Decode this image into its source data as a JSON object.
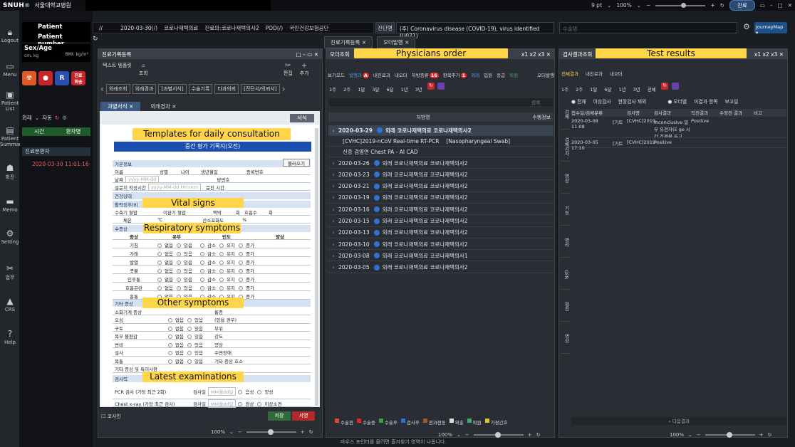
{
  "topbar": {
    "logo": "SNUH",
    "logo_sup": "®",
    "hospital": "서울대학교병원",
    "font_size": "9 pt",
    "zoom": "100%",
    "mode": "진료"
  },
  "rail": {
    "items": [
      "Logout",
      "Menu",
      "Patient List",
      "Patient Summary",
      "회진",
      "Memo",
      "Setting",
      "업무",
      "CRS",
      "Help"
    ]
  },
  "patient": {
    "name_label": "Patient name",
    "number_label": "Patient number",
    "sexage": "Sex/Age",
    "measures": "cm, kg",
    "bmi": "BMI: kg/m²",
    "badge_r": "R",
    "badge_ttl": "진료\n회송",
    "dept": "외래",
    "auto": "자동",
    "hist_cols": [
      "시간",
      "환자명"
    ],
    "hist_section": "진료분환자",
    "hist_date": "2020-03-30 11:01:16"
  },
  "infobar": {
    "sep": "//",
    "date": "2020-03-30(/)",
    "dept": "코로나재택의료",
    "doctor": "진료의:코로나재택의사2",
    "pod": "POD(/)",
    "insurance": "국민건강보험공단"
  },
  "dx": {
    "label": "진단명",
    "value": "(주) Coronavirus disease (COVID-19), virus identified (U071)",
    "search_ph": "수술명"
  },
  "journey": "JourneyMap ▾",
  "tabs": [
    "진료기록등록",
    "오더발행"
  ],
  "p1": {
    "title": "진료기록등록",
    "tools": [
      "텍스트 템플릿",
      "조회",
      "편집",
      "추가"
    ],
    "chips": [
      "외래조회",
      "외래경과",
      "[과별서식]",
      "수술기록",
      "타과의뢰",
      "[진단서/의뢰서]"
    ],
    "subtabs": [
      "과별서식",
      "외래경과"
    ],
    "format_btn": "서식",
    "annotation_templates": "Templates for daily consultation",
    "form_title": "중간 평가 기록지(오전)",
    "load_btn": "불러오기",
    "annotation_vitals": "Vital signs",
    "annotation_resp": "Respiratory symptoms",
    "annotation_other": "Other symptoms",
    "annotation_exam": "Latest examinations",
    "sections": {
      "basic": "기본정보",
      "health": "건강상태",
      "vital": "활력징후(비",
      "symptom": "수증상",
      "other": "기타 증상",
      "exam": "검사력"
    },
    "fields": {
      "name": "이름",
      "sex": "성별",
      "age": "나이",
      "dob": "생년월일",
      "reg": "등록번호",
      "date": "날짜",
      "date_ph": "yyyy-MM-dd",
      "ward": "방번호",
      "survey": "설문지 작성시간",
      "survey_ph": "yyyy-MM-dd HH:mm",
      "consult": "문진 시간",
      "sbp": "수축기 혈압",
      "dbp": "이완기 혈압",
      "pulse": "맥박",
      "times": "회",
      "resp": "호흡수",
      "temp": "체온",
      "celsius": "℃",
      "spo2": "산소포화도",
      "pct": "%"
    },
    "sym_cols": [
      "증상",
      "유무",
      "빈도",
      "양상"
    ],
    "symptoms": [
      "기침",
      "가래",
      "발열",
      "콧물",
      "인후통",
      "호흡곤란",
      "흉통"
    ],
    "opts": {
      "no": "없음",
      "yes": "있음",
      "dec": "감소",
      "same": "유지",
      "inc": "증가"
    },
    "other_rows": [
      "소화기계 증상",
      "오심",
      "구토",
      "복부 불편감",
      "변비",
      "설사",
      "복통",
      "기타 증상 및 특이사항"
    ],
    "other_right": [
      "통증",
      "(있을 경우)",
      "부위",
      "강도",
      "양상",
      "수면장애",
      "기타 증상 호소"
    ],
    "exams": [
      "PCR 검사 (가장 최근 2회)",
      "Chest x-ray (가장 최근 검사)"
    ],
    "exam_date": "검사일",
    "exam_ph": "MM월dd일",
    "pos": "음성",
    "neg": "양성",
    "normal": "정상",
    "abnormal": "이상소견",
    "check": "코사인",
    "save": "저장",
    "sign": "서명",
    "zoom": "100%"
  },
  "p2": {
    "title": "오더조회",
    "header": "Physicians order",
    "win": [
      "x1",
      "x2",
      "x3"
    ],
    "tools": [
      "보기모드",
      "발행과",
      "내진료과",
      "내오더",
      "처방종류",
      "항목추가",
      "외래",
      "입원",
      "응급",
      "퇴원",
      "오더발행"
    ],
    "badges": [
      "A",
      "16",
      "1"
    ],
    "timeline": [
      "1주",
      "2주",
      "1달",
      "3달",
      "6달",
      "1년",
      "3년"
    ],
    "search_ph": "검색",
    "cols": [
      "처방명",
      "수행정보"
    ],
    "first": {
      "date": "2020-03-29",
      "desc": "외래 코로나재택의료 코로나재택의사2",
      "sub1": "[CVHC]2019-nCoV Real-time RT-PCR",
      "sub1b": "[Nasopharyngeal Swab]",
      "sub2": "신증 검영연 Chest PA - AI CAD"
    },
    "rows": [
      {
        "date": "2020-03-26",
        "desc": "외래 코로나재택의료 코로나재택의사2"
      },
      {
        "date": "2020-03-23",
        "desc": "외래 코로나재택의료 코로나재택의사2"
      },
      {
        "date": "2020-03-21",
        "desc": "외래 코로나재택의료 코로나재택의사2"
      },
      {
        "date": "2020-03-19",
        "desc": "외래 코로나재택의료 코로나재택의사2"
      },
      {
        "date": "2020-03-16",
        "desc": "외래 코로나재택의료 코로나재택의사2"
      },
      {
        "date": "2020-03-15",
        "desc": "외래 코로나재택의료 코로나재택의사2"
      },
      {
        "date": "2020-03-13",
        "desc": "외래 코로나재택의료 코로나재택의사2"
      },
      {
        "date": "2020-03-10",
        "desc": "외래 코로나재택의료 코로나재택의사2"
      },
      {
        "date": "2020-03-08",
        "desc": "외래 코로나재택의료 코로나재택의사1"
      },
      {
        "date": "2020-03-05",
        "desc": "외래 코로나재택의료 코로나재택의사2"
      }
    ],
    "legend": [
      {
        "label": "수술전",
        "color": "#e04a2a"
      },
      {
        "label": "수술중",
        "color": "#e0262b"
      },
      {
        "label": "수술후",
        "color": "#3ba04a"
      },
      {
        "label": "검사후",
        "color": "#2b73d6"
      },
      {
        "label": "전과전동",
        "color": "#9a5a2a"
      },
      {
        "label": "외출",
        "color": "#dddddd"
      },
      {
        "label": "퇴원",
        "color": "#3fae6a"
      },
      {
        "label": "가정간호",
        "color": "#d8c62a"
      }
    ],
    "zoom": "100%",
    "hint": "마우스 포인터를 올려면 즐겨찾기 영역이 나옵니다."
  },
  "p3": {
    "title": "검사결과조회",
    "header": "Test results",
    "win": [
      "x1",
      "x2",
      "x3"
    ],
    "tools": [
      "전체결과",
      "내진료과",
      "내오더"
    ],
    "timeline": [
      "1주",
      "2주",
      "1달",
      "6달",
      "1년",
      "3년",
      "전체"
    ],
    "filters": [
      "전체",
      "이상검사",
      "현장검사 제외",
      "오더별",
      "미결과 항목",
      "보고일"
    ],
    "cols": [
      "접수일/검체분류",
      "검사명",
      "검사결과",
      "직전결과",
      "수정전 결과",
      "비고"
    ],
    "rows": [
      {
        "d": "2020-03-08 11:08",
        "t": "[기트",
        "n": "[CVHC]2019-",
        "r": "Inconclusive 일부 유전자(E ge 시간 간격을 두고",
        "p": "Positive"
      },
      {
        "d": "2020-03-05 17:10",
        "t": "[기트",
        "n": "[CVHC]2019-",
        "r": "Positive",
        "p": ""
      }
    ],
    "vtabs": [
      "검체",
      "검체검사",
      "영상",
      "기능",
      "병리",
      "GFR",
      "협진",
      "영상"
    ],
    "next": "다음결과",
    "zoom": "100%"
  }
}
